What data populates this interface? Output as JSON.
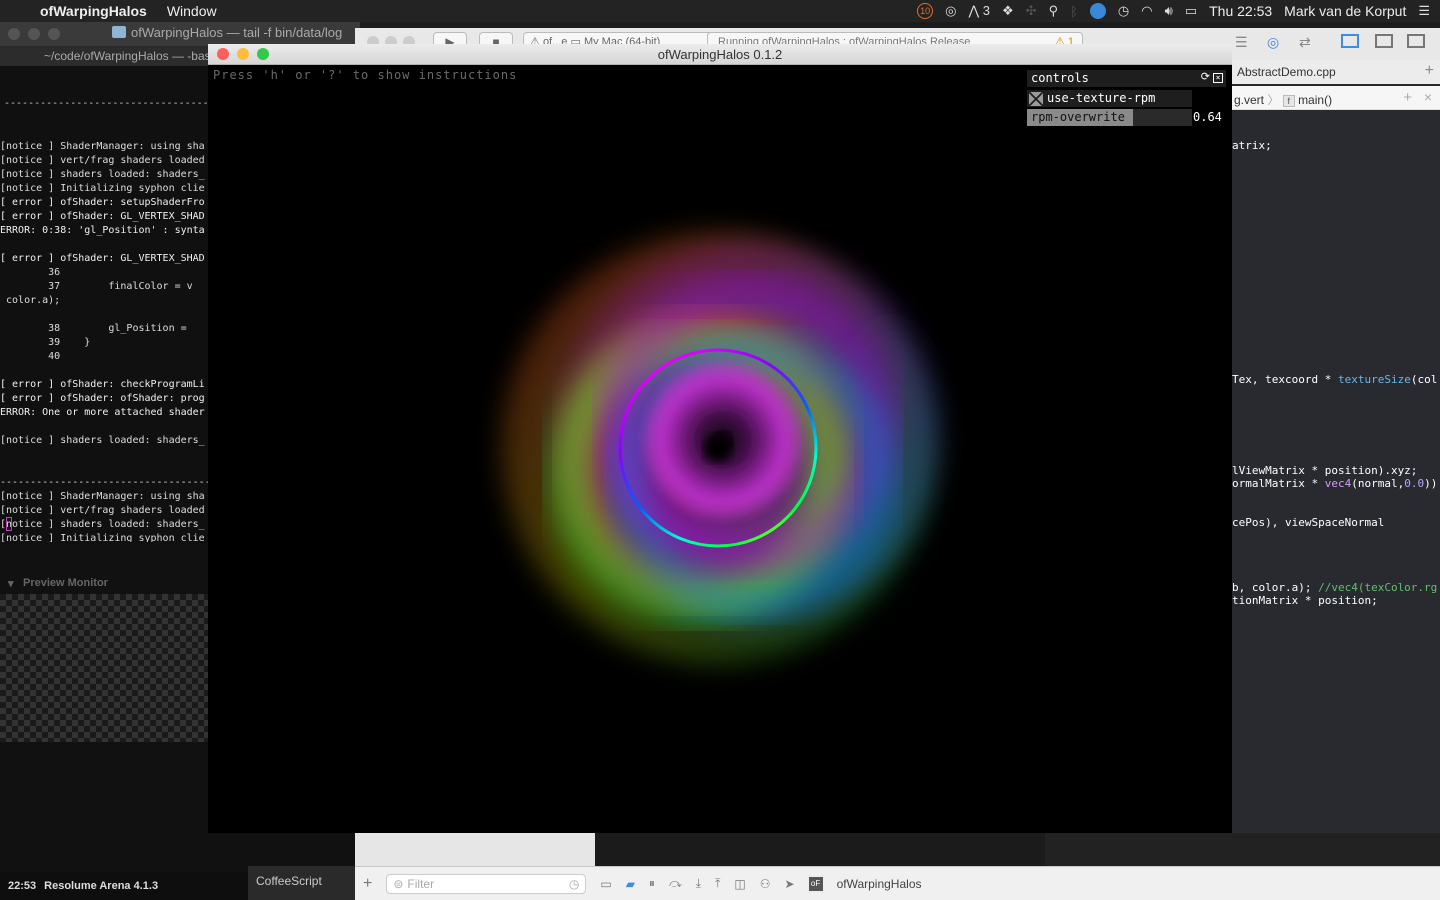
{
  "menubar": {
    "app_name": "ofWarpingHalos",
    "menu_window": "Window",
    "notif_count": "10",
    "adobe_count": "3",
    "clock": "Thu 22:53",
    "user": "Mark van de Korput"
  },
  "terminal": {
    "title": "ofWarpingHalos — tail -f bin/data/log",
    "path": "~/code/ofWarpingHalos — -bas",
    "log": [
      "[notice ] ShaderManager: using sha",
      "[notice ] vert/frag shaders loaded",
      "[notice ] shaders loaded: shaders_",
      "[notice ] Initializing syphon clie",
      "[ error ] ofShader: setupShaderFro",
      "[ error ] ofShader: GL_VERTEX_SHAD",
      "ERROR: 0:38: 'gl_Position' : synta",
      "",
      "[ error ] ofShader: GL_VERTEX_SHAD",
      "        36",
      "        37        finalColor = v",
      " color.a);",
      "",
      "        38        gl_Position =",
      "        39    }",
      "        40",
      "",
      "[ error ] ofShader: checkProgramLi",
      "[ error ] ofShader: ofShader: prog",
      "ERROR: One or more attached shader",
      "",
      "[notice ] shaders loaded: shaders_",
      "",
      "",
      "-----------------------------------",
      "[notice ] ShaderManager: using sha",
      "[notice ] vert/frag shaders loaded",
      "[notice ] shaders loaded: shaders_",
      "[notice ] Initializing syphon clie",
      "[notice ] shaders loaded: shaders_"
    ],
    "separator": "-----------------------------------"
  },
  "resolume": {
    "preview_monitor": "Preview Monitor",
    "status_time": "22:53",
    "status_app": "Resolume Arena 4.1.3"
  },
  "xcode": {
    "scheme": "of...e",
    "destination": "My Mac (64-bit)",
    "activity": "Running ofWarpingHalos : ofWarpingHalos Release",
    "warnings": "1",
    "tab_file": "AbstractDemo.cpp",
    "jump_file": "g.vert",
    "jump_func": "main()",
    "filter_placeholder": "Filter",
    "target_name": "ofWarpingHalos",
    "bottom_lang": "CoffeeScript"
  },
  "app": {
    "title": "ofWarpingHalos 0.1.2",
    "instructions": "Press 'h' or '?' to show instructions",
    "controls": {
      "header": "controls",
      "toggle_label": "use-texture-rpm",
      "toggle_checked": true,
      "slider_label": "rpm-overwrite",
      "slider_value": "0.64",
      "slider_fraction": 0.64
    }
  },
  "colors": {
    "ring_gradient": [
      "#ff00ff",
      "#8a00ff",
      "#0033ff",
      "#00ffff",
      "#00ff40",
      "#ffff00",
      "#ff8000",
      "#ff0000"
    ]
  }
}
